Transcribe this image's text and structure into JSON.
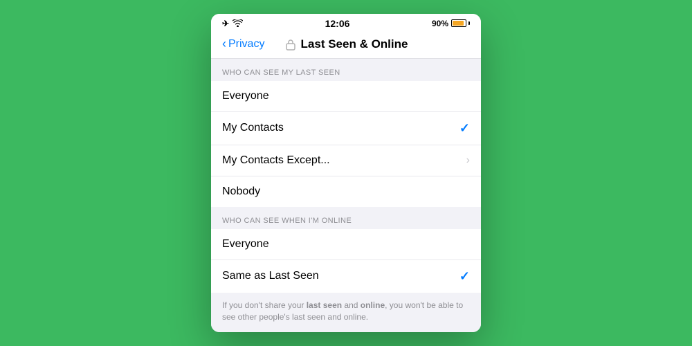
{
  "statusBar": {
    "time": "12:06",
    "battery": "90%",
    "airplane_icon": "✈",
    "wifi_icon": "wifi"
  },
  "navBar": {
    "backLabel": "Privacy",
    "title": "Last Seen & Online"
  },
  "section1": {
    "header": "WHO CAN SEE MY LAST SEEN",
    "items": [
      {
        "label": "Everyone",
        "checked": false,
        "hasChevron": false
      },
      {
        "label": "My Contacts",
        "checked": true,
        "hasChevron": false
      },
      {
        "label": "My Contacts Except...",
        "checked": false,
        "hasChevron": true
      },
      {
        "label": "Nobody",
        "checked": false,
        "hasChevron": false
      }
    ]
  },
  "section2": {
    "header": "WHO CAN SEE WHEN I'M ONLINE",
    "items": [
      {
        "label": "Everyone",
        "checked": false,
        "hasChevron": false
      },
      {
        "label": "Same as Last Seen",
        "checked": true,
        "hasChevron": false
      }
    ]
  },
  "footer": {
    "text_prefix": "If you don't share your ",
    "bold1": "last seen",
    "text_mid": " and ",
    "bold2": "online",
    "text_suffix": ", you won't be able to see other people's last seen and online."
  }
}
